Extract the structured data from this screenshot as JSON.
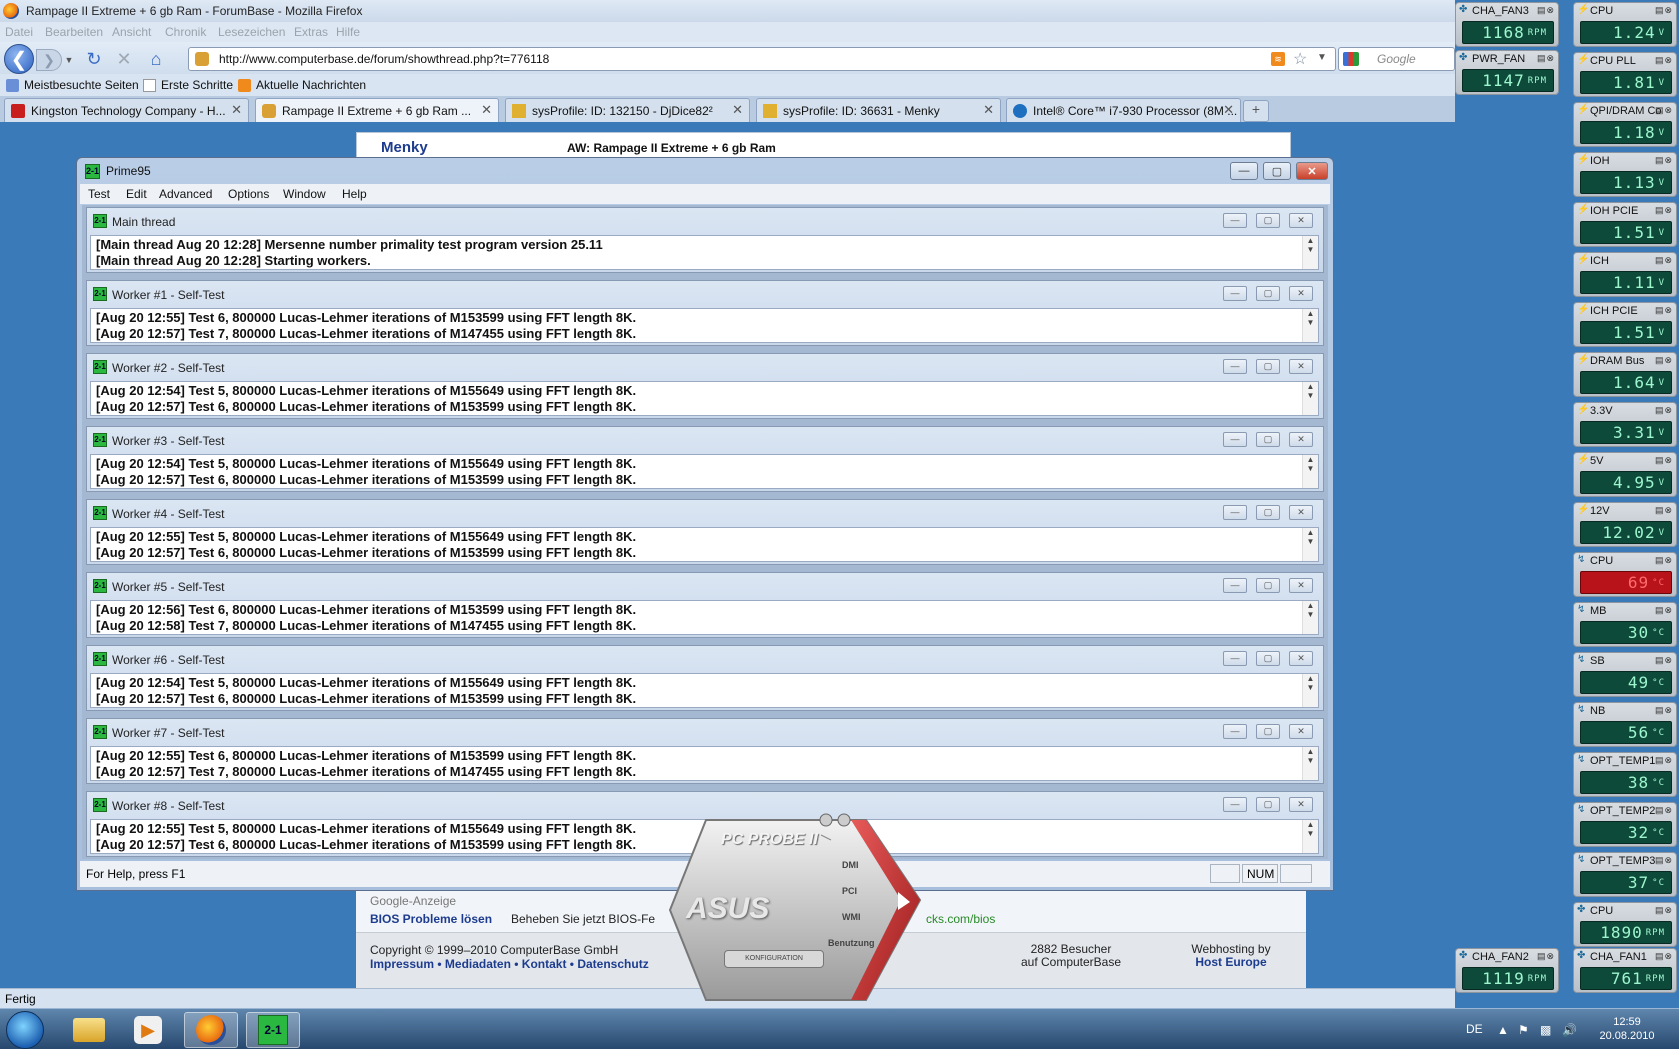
{
  "firefox": {
    "title": "Rampage II Extreme + 6 gb Ram - ForumBase - Mozilla Firefox",
    "menus": [
      "Datei",
      "Bearbeiten",
      "Ansicht",
      "Chronik",
      "Lesezeichen",
      "Extras",
      "Hilfe"
    ],
    "url": "http://www.computerbase.de/forum/showthread.php?t=776118",
    "search_placeholder": "Google",
    "bookmarks": [
      "Meistbesuchte Seiten",
      "Erste Schritte",
      "Aktuelle Nachrichten"
    ],
    "tabs": [
      {
        "label": "Kingston Technology Company - H...",
        "active": false
      },
      {
        "label": "Rampage II Extreme + 6 gb Ram ...",
        "active": true
      },
      {
        "label": "sysProfile: ID: 132150 - DjDice82²",
        "active": false
      },
      {
        "label": "sysProfile: ID: 36631 - Menky",
        "active": false
      },
      {
        "label": "Intel® Core™ i7-930 Processor (8M ...",
        "active": false
      }
    ],
    "status": "Fertig"
  },
  "webpage": {
    "post_user": "Menky",
    "post_title": "AW: Rampage II Extreme + 6 gb Ram",
    "ad_label": "Google-Anzeige",
    "ad_link": "BIOS Probleme lösen",
    "ad_text": "Beheben Sie jetzt BIOS-Fe",
    "ad_url": "cks.com/bios",
    "copyright": "Copyright © 1999–2010 ComputerBase GmbH",
    "footer_links": [
      "Impressum",
      "Mediadaten",
      "Kontakt",
      "Datenschutz"
    ],
    "visitors_line1": "2882 Besucher",
    "visitors_line2": "auf ComputerBase",
    "hosting_line1": "Webhosting by",
    "hosting_line2": "Host Europe"
  },
  "prime95": {
    "title": "Prime95",
    "menus": [
      "Test",
      "Edit",
      "Advanced",
      "Options",
      "Window",
      "Help"
    ],
    "status": "For Help, press F1",
    "num_indicator": "NUM",
    "panes": [
      {
        "title": "Main thread",
        "lines": [
          "[Main thread Aug 20 12:28] Mersenne number primality test program version 25.11",
          "[Main thread Aug 20 12:28] Starting workers."
        ]
      },
      {
        "title": "Worker #1 - Self-Test",
        "lines": [
          "[Aug 20 12:55] Test 6, 800000 Lucas-Lehmer iterations of M153599 using FFT length 8K.",
          "[Aug 20 12:57] Test 7, 800000 Lucas-Lehmer iterations of M147455 using FFT length 8K."
        ]
      },
      {
        "title": "Worker #2 - Self-Test",
        "lines": [
          "[Aug 20 12:54] Test 5, 800000 Lucas-Lehmer iterations of M155649 using FFT length 8K.",
          "[Aug 20 12:57] Test 6, 800000 Lucas-Lehmer iterations of M153599 using FFT length 8K."
        ]
      },
      {
        "title": "Worker #3 - Self-Test",
        "lines": [
          "[Aug 20 12:54] Test 5, 800000 Lucas-Lehmer iterations of M155649 using FFT length 8K.",
          "[Aug 20 12:57] Test 6, 800000 Lucas-Lehmer iterations of M153599 using FFT length 8K."
        ]
      },
      {
        "title": "Worker #4 - Self-Test",
        "lines": [
          "[Aug 20 12:55] Test 5, 800000 Lucas-Lehmer iterations of M155649 using FFT length 8K.",
          "[Aug 20 12:57] Test 6, 800000 Lucas-Lehmer iterations of M153599 using FFT length 8K."
        ]
      },
      {
        "title": "Worker #5 - Self-Test",
        "lines": [
          "[Aug 20 12:56] Test 6, 800000 Lucas-Lehmer iterations of M153599 using FFT length 8K.",
          "[Aug 20 12:58] Test 7, 800000 Lucas-Lehmer iterations of M147455 using FFT length 8K."
        ]
      },
      {
        "title": "Worker #6 - Self-Test",
        "lines": [
          "[Aug 20 12:54] Test 5, 800000 Lucas-Lehmer iterations of M155649 using FFT length 8K.",
          "[Aug 20 12:57] Test 6, 800000 Lucas-Lehmer iterations of M153599 using FFT length 8K."
        ]
      },
      {
        "title": "Worker #7 - Self-Test",
        "lines": [
          "[Aug 20 12:55] Test 6, 800000 Lucas-Lehmer iterations of M153599 using FFT length 8K.",
          "[Aug 20 12:57] Test 7, 800000 Lucas-Lehmer iterations of M147455 using FFT length 8K."
        ]
      },
      {
        "title": "Worker #8 - Self-Test",
        "lines": [
          "[Aug 20 12:55] Test 5, 800000 Lucas-Lehmer iterations of M155649 using FFT length 8K.",
          "[Aug 20 12:57] Test 6, 800000 Lucas-Lehmer iterations of M153599 using FFT length 8K."
        ]
      }
    ]
  },
  "sensors_left": [
    {
      "label": "CHA_FAN3",
      "type": "fan",
      "value": "1168",
      "unit": "RPM"
    },
    {
      "label": "PWR_FAN",
      "type": "fan",
      "value": "1147",
      "unit": "RPM"
    }
  ],
  "sensors_right": [
    {
      "label": "CPU",
      "type": "voltage",
      "value": "1.24",
      "unit": "V",
      "alarm": false
    },
    {
      "label": "CPU PLL",
      "type": "voltage",
      "value": "1.81",
      "unit": "V",
      "alarm": false
    },
    {
      "label": "QPI/DRAM Co",
      "type": "voltage",
      "value": "1.18",
      "unit": "V",
      "alarm": false
    },
    {
      "label": "IOH",
      "type": "voltage",
      "value": "1.13",
      "unit": "V",
      "alarm": false
    },
    {
      "label": "IOH PCIE",
      "type": "voltage",
      "value": "1.51",
      "unit": "V",
      "alarm": false
    },
    {
      "label": "ICH",
      "type": "voltage",
      "value": "1.11",
      "unit": "V",
      "alarm": false
    },
    {
      "label": "ICH PCIE",
      "type": "voltage",
      "value": "1.51",
      "unit": "V",
      "alarm": false
    },
    {
      "label": "DRAM Bus",
      "type": "voltage",
      "value": "1.64",
      "unit": "V",
      "alarm": false
    },
    {
      "label": "3.3V",
      "type": "voltage",
      "value": "3.31",
      "unit": "V",
      "alarm": false
    },
    {
      "label": "5V",
      "type": "voltage",
      "value": "4.95",
      "unit": "V",
      "alarm": false
    },
    {
      "label": "12V",
      "type": "voltage",
      "value": "12.02",
      "unit": "V",
      "alarm": false
    },
    {
      "label": "CPU",
      "type": "temperature",
      "value": "69",
      "unit": "°C",
      "alarm": true
    },
    {
      "label": "MB",
      "type": "temperature",
      "value": "30",
      "unit": "°C",
      "alarm": false
    },
    {
      "label": "SB",
      "type": "temperature",
      "value": "49",
      "unit": "°C",
      "alarm": false
    },
    {
      "label": "NB",
      "type": "temperature",
      "value": "56",
      "unit": "°C",
      "alarm": false
    },
    {
      "label": "OPT_TEMP1",
      "type": "temperature",
      "value": "38",
      "unit": "°C",
      "alarm": false
    },
    {
      "label": "OPT_TEMP2",
      "type": "temperature",
      "value": "32",
      "unit": "°C",
      "alarm": false
    },
    {
      "label": "OPT_TEMP3",
      "type": "temperature",
      "value": "37",
      "unit": "°C",
      "alarm": false
    },
    {
      "label": "CPU",
      "type": "fan",
      "value": "1890",
      "unit": "RPM",
      "alarm": false
    }
  ],
  "sensors_bottom": [
    {
      "label": "CHA_FAN2",
      "type": "fan",
      "value": "1119",
      "unit": "RPM"
    },
    {
      "label": "CHA_FAN1",
      "type": "fan",
      "value": "761",
      "unit": "RPM"
    }
  ],
  "pcprobe": {
    "title": "PC PROBE II",
    "brand": "ASUS",
    "config": "KONFIGURATION",
    "menu": [
      "DMI",
      "PCI",
      "WMI",
      "Benutzung"
    ]
  },
  "taskbar": {
    "lang": "DE",
    "time": "12:59",
    "date": "20.08.2010"
  }
}
